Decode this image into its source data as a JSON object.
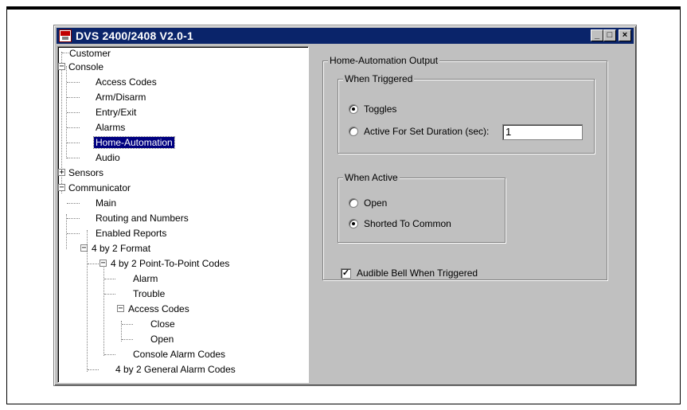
{
  "window": {
    "title": "DVS 2400/2408 V2.0-1",
    "minimize_label": "_",
    "maximize_label": "□",
    "close_label": "×"
  },
  "tree": {
    "customer": "Customer",
    "console": "Console",
    "access_codes": "Access Codes",
    "arm_disarm": "Arm/Disarm",
    "entry_exit": "Entry/Exit",
    "alarms": "Alarms",
    "home_automation": "Home-Automation",
    "audio": "Audio",
    "sensors": "Sensors",
    "communicator": "Communicator",
    "main": "Main",
    "routing": "Routing and Numbers",
    "enabled_reports": "Enabled Reports",
    "format_4by2": "4 by 2 Format",
    "ptp_codes": "4 by 2 Point-To-Point Codes",
    "alarm": "Alarm",
    "trouble": "Trouble",
    "access_codes_sub": "Access Codes",
    "close": "Close",
    "open": "Open",
    "console_alarm_codes": "Console Alarm Codes",
    "general_alarm_codes": "4 by 2 General Alarm Codes",
    "collapse_glyph": "−",
    "expand_glyph": "+"
  },
  "panel": {
    "output_group": "Home-Automation Output",
    "when_triggered": {
      "label": "When Triggered",
      "toggles": "Toggles",
      "active_duration": "Active For Set Duration (sec):",
      "duration_value": "1"
    },
    "when_active": {
      "label": "When Active",
      "open": "Open",
      "shorted": "Shorted To Common"
    },
    "audible_bell": {
      "label": "Audible Bell When Triggered",
      "checked_glyph": "✓"
    }
  }
}
